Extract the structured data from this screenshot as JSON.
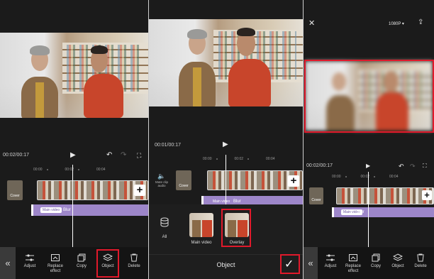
{
  "panel1": {
    "time": "00:02/00:17",
    "ruler": [
      "00:00",
      "00:02",
      "00:04"
    ],
    "cover_label": "Cover",
    "track_tag": "Main video",
    "track_label": "Blur",
    "toolbar": [
      {
        "icon": "adjust-icon",
        "label": "Adjust"
      },
      {
        "icon": "replace-effect-icon",
        "label": "Replace effect"
      },
      {
        "icon": "copy-icon",
        "label": "Copy"
      },
      {
        "icon": "object-icon",
        "label": "Object"
      },
      {
        "icon": "delete-icon",
        "label": "Delete"
      }
    ]
  },
  "panel2": {
    "time": "00:01/00:17",
    "ruler": [
      "00:00",
      "00:02",
      "00:04"
    ],
    "mute_label": "Mute clip audio",
    "cover_label": "Cover",
    "track_tag": "Main video",
    "track_label": "Blur",
    "all_label": "All",
    "options": [
      {
        "label": "Main video"
      },
      {
        "label": "Overlay"
      }
    ],
    "sheet_title": "Object"
  },
  "panel3": {
    "resolution": "1080P",
    "ruler": [
      "00:00",
      "00:02",
      "00:04"
    ],
    "time": "00:02/00:17",
    "cover_label": "Cover",
    "track_tag": "Main video",
    "track_label": "Blur",
    "toolbar": [
      {
        "icon": "adjust-icon",
        "label": "Adjust"
      },
      {
        "icon": "replace-effect-icon",
        "label": "Replace effect"
      },
      {
        "icon": "copy-icon",
        "label": "Copy"
      },
      {
        "icon": "object-icon",
        "label": "Object"
      },
      {
        "icon": "delete-icon",
        "label": "Delete"
      }
    ]
  },
  "colors": {
    "highlight": "#e0192b",
    "track": "#9d86c9",
    "background": "#1b1b1b"
  }
}
